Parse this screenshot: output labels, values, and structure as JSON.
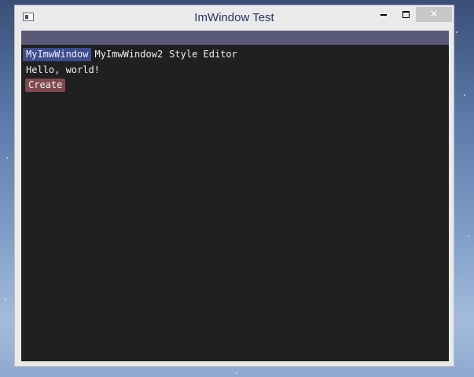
{
  "window": {
    "title": "ImWindow Test",
    "minimize_glyph": "minimize",
    "maximize_glyph": "maximize",
    "close_label": "✕"
  },
  "tabs": [
    {
      "label": "MyImwWindow",
      "active": true
    },
    {
      "label": "MyImwWindow2",
      "active": false
    },
    {
      "label": "Style Editor",
      "active": false
    }
  ],
  "content": {
    "text": "Hello, world!",
    "button_label": "Create"
  },
  "colors": {
    "client_bg": "#202020",
    "menubar_bg": "#5a5a78",
    "active_tab_bg": "#3c4c8c",
    "button_bg": "#80494e",
    "title_text": "#2a3563"
  }
}
